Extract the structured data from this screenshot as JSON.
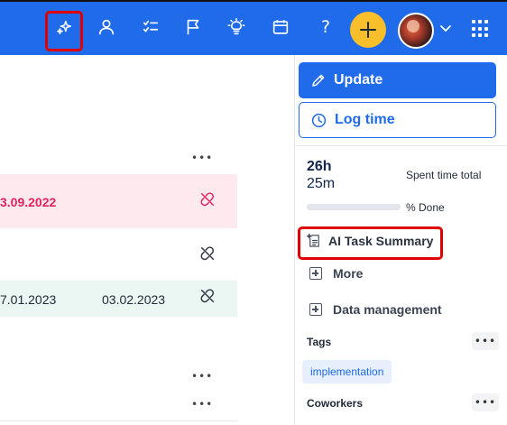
{
  "topbar": {
    "icons": [
      "ai-sparkle-icon",
      "user-icon",
      "task-list-icon",
      "flag-icon",
      "lightbulb-icon",
      "calendar-icon",
      "help-icon",
      "add-icon",
      "avatar",
      "chevron-down-icon",
      "apps-grid-icon"
    ],
    "help_glyph": "?",
    "accent": "#1f6bea",
    "add_color": "#f9bf2a"
  },
  "list": {
    "row_more": "•••",
    "pink_row_date": "3.09.2022",
    "green_row_start": "7.01.2023",
    "green_row_end": "03.02.2023",
    "highlight_color": "#e0245e"
  },
  "panel": {
    "update_label": "Update",
    "log_time_label": "Log time",
    "hours": "26h",
    "minutes": "25m",
    "spent_label": "Spent time total",
    "progress_percent": 0,
    "done_label": "% Done",
    "ai_summary_label": "AI Task Summary",
    "more_label": "More",
    "data_management_label": "Data management",
    "tags_label": "Tags",
    "tag": "implementation",
    "coworkers_label": "Coworkers",
    "section_more": "•••"
  }
}
